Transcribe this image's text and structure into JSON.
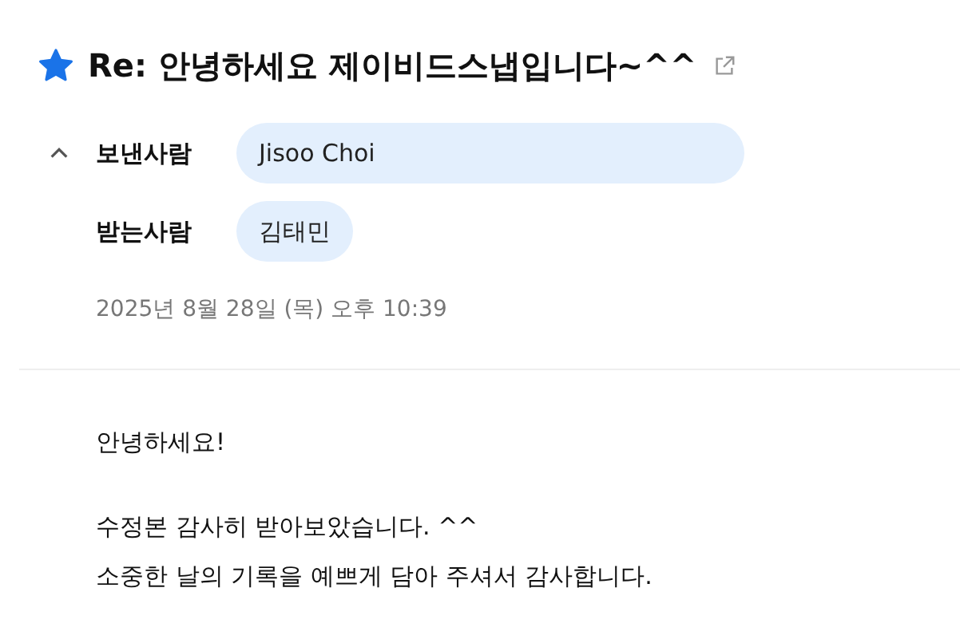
{
  "message": {
    "title": "Re: 안녕하세요 제이비드스냅입니다~^^",
    "starred": true,
    "expanded": true,
    "sender": {
      "label": "보낸사람",
      "name": "Jisoo Choi"
    },
    "recipient": {
      "label": "받는사람",
      "name": "김태민"
    },
    "date": "2025년 8월 28일 (목) 오후 10:39",
    "body": [
      [
        "안녕하세요!"
      ],
      [
        "수정본 감사히 받아보았습니다. ^^",
        "소중한 날의 기록을 예쁘게 담아 주셔서 감사합니다."
      ]
    ]
  }
}
